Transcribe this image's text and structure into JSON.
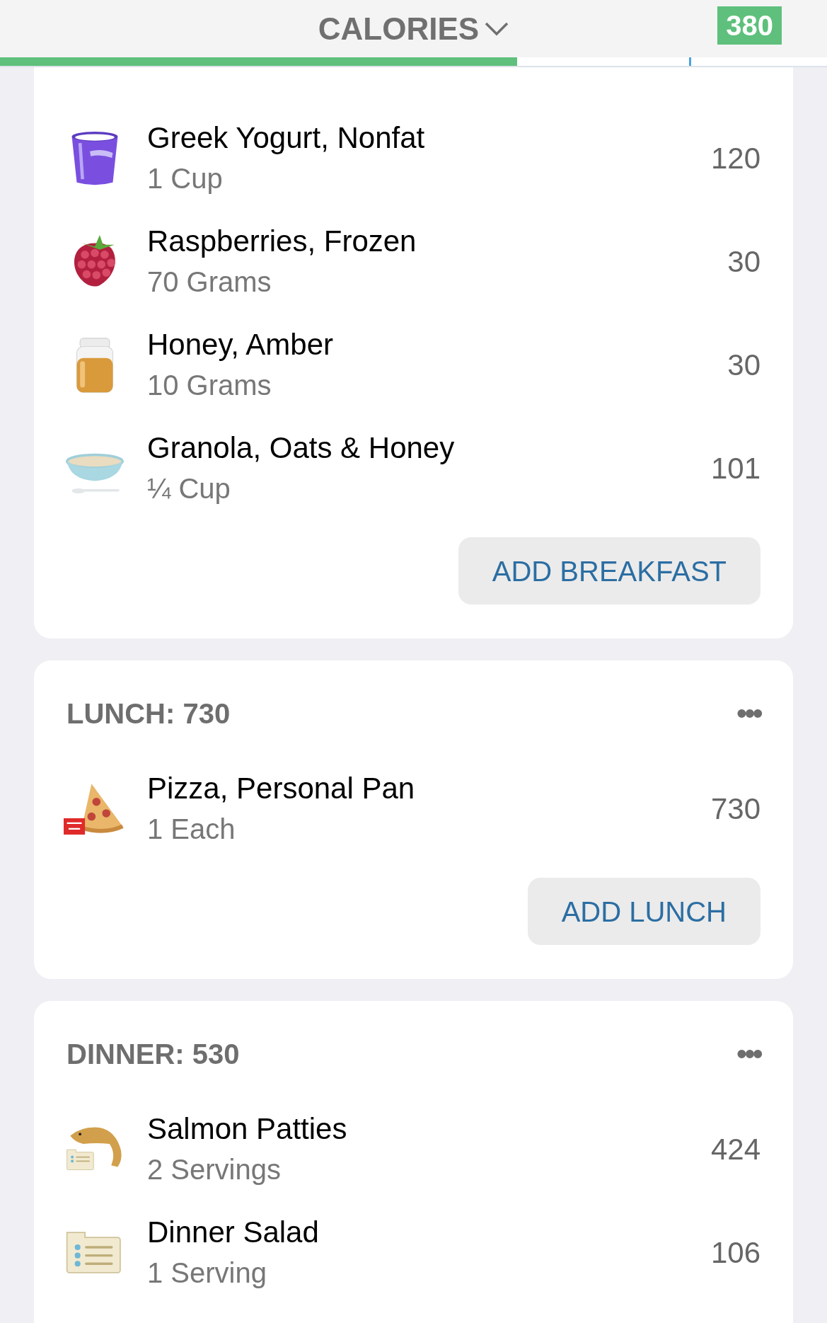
{
  "header": {
    "title": "CALORIES",
    "badge": "380"
  },
  "progress": {
    "level": 0.625,
    "goal": {
      "level": 0.833
    }
  },
  "meals": [
    {
      "foods": [
        {
          "name": "Greek Yogurt, Nonfat",
          "amount": "1 Cup",
          "calories": "120",
          "kind": "yogurt"
        },
        {
          "name": "Raspberries, Frozen",
          "amount": "70 Grams",
          "calories": "30",
          "kind": "berry"
        },
        {
          "name": "Honey, Amber",
          "amount": "10 Grams",
          "calories": "30",
          "kind": "jar"
        },
        {
          "name": "Granola, Oats & Honey",
          "amount": "¼ Cup",
          "calories": "101",
          "kind": "bowl"
        }
      ],
      "button": "ADD BREAKFAST"
    },
    {
      "title": "LUNCH: 730",
      "menu": "•••",
      "foods": [
        {
          "name": "Pizza, Personal Pan",
          "amount": "1 Each",
          "calories": "730",
          "kind": "pizza"
        }
      ],
      "button": "ADD LUNCH"
    },
    {
      "title": "DINNER: 530",
      "menu": "•••",
      "foods": [
        {
          "name": "Salmon Patties",
          "amount": "2 Servings",
          "calories": "424",
          "kind": "fish"
        },
        {
          "name": "Dinner Salad",
          "amount": "1 Serving",
          "calories": "106",
          "kind": "recipe"
        }
      ]
    }
  ]
}
